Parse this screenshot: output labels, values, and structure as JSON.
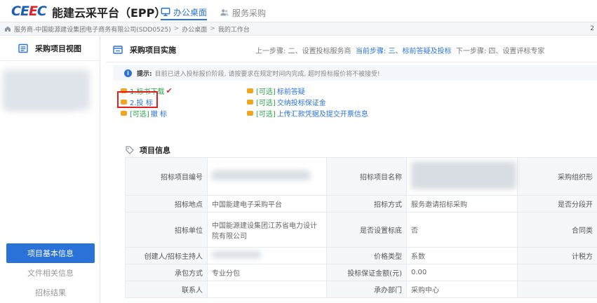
{
  "header": {
    "logo_text": "CEEC",
    "brand": "能建云采平台（EPP）",
    "nav": [
      {
        "label": "办公桌面",
        "icon": "monitor-icon",
        "active": true
      },
      {
        "label": "服务采购",
        "icon": "users-icon",
        "active": false
      }
    ]
  },
  "breadcrumb": {
    "items": [
      "服务商-中国能源建设集团电子商务有限公司(SDD0525)",
      "办公桌面",
      "我的工作台"
    ],
    "right_text": "2"
  },
  "sidebar": {
    "title": "采购项目视图",
    "menu": [
      {
        "label": "项目基本信息",
        "active": true
      },
      {
        "label": "文件相关信息",
        "active": false
      },
      {
        "label": "招标结果",
        "active": false
      }
    ]
  },
  "main": {
    "title": "采购项目实施",
    "steps": {
      "prev_label": "上一步骤: ",
      "prev": "二、设置投标服务商",
      "cur_label": "当前步骤: ",
      "cur": "三、标前答疑及投标",
      "next_label": "下一步骤: ",
      "next": "四、设置评标专家"
    },
    "notice": {
      "prefix": "提示:",
      "text": "目前已进入投标报价阶段, 请按要求在规定时间内完成, 超时投标报价将不被接受!"
    },
    "tasks": {
      "t1": "1.标书下载",
      "t1_mark": "✔",
      "t2": "2.投 标",
      "t3_opt": "[可选]",
      "t3": "撤 标",
      "t4_opt": "[可选]",
      "t4": "标前答疑",
      "t5_opt": "[可选]",
      "t5": "交纳投标保证金",
      "t6_opt": "[可选]",
      "t6": "上传汇款凭据及提交开票信息"
    },
    "section_title": "项目信息",
    "table": {
      "r1": {
        "l1": "招标项目编号",
        "l2": "招标项目名称",
        "l3": "采购组织形"
      },
      "r2": {
        "l1": "招标地点",
        "v1": "中国能建电子采购平台",
        "l2": "招标方式",
        "v2": "服务邀请招标采购",
        "l3": "是否分段开"
      },
      "r3": {
        "l1": "招标单位",
        "v1": "中国能源建设集团江苏省电力设计院有限公司",
        "l2": "是否设置标底",
        "v2": "否",
        "l3": "合同类"
      },
      "r4": {
        "l1": "创建人/招标主持人",
        "l2": "价格类型",
        "v2": "系数",
        "l3": "计税方"
      },
      "r5": {
        "l1": "承包方式",
        "v1": "专业分包",
        "l2": "投标保证金额(元)",
        "v2": "0.00"
      },
      "r6": {
        "l1": "联系人",
        "l2": "承办部门",
        "v2": "采购中心"
      }
    }
  }
}
